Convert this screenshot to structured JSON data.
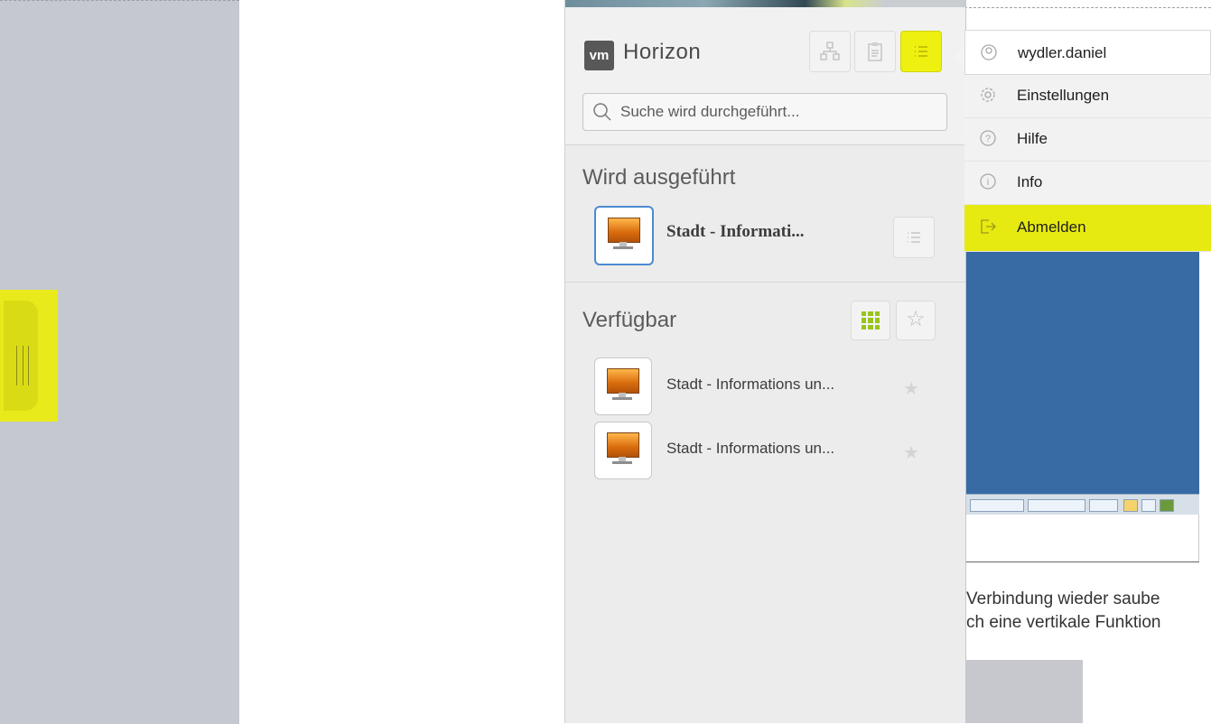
{
  "sidebar": {
    "brand": "Horizon",
    "logo_text": "vm",
    "search_placeholder": "Suche wird durchgeführt...",
    "header_buttons": [
      "hierarchy-icon",
      "clipboard-icon",
      "menu-list-icon"
    ],
    "running_title": "Wird ausgeführt",
    "running_items": [
      {
        "name": "Stadt - Informati..."
      }
    ],
    "available_title": "Verfügbar",
    "available_items": [
      {
        "name": "Stadt - Informations un..."
      },
      {
        "name": "Stadt - Informations un..."
      }
    ]
  },
  "menu": {
    "user": "wydler.daniel",
    "items": [
      {
        "label": "Einstellungen",
        "icon": "gear-icon"
      },
      {
        "label": "Hilfe",
        "icon": "help-icon"
      },
      {
        "label": "Info",
        "icon": "info-icon"
      },
      {
        "label": "Abmelden",
        "icon": "logout-icon"
      }
    ]
  },
  "background": {
    "line1": "Verbindung wieder saube",
    "line2": "ch eine vertikale Funktion"
  },
  "colors": {
    "highlight": "#e7ea10",
    "panel": "#ececec",
    "desktop_blue": "#386aa3"
  }
}
